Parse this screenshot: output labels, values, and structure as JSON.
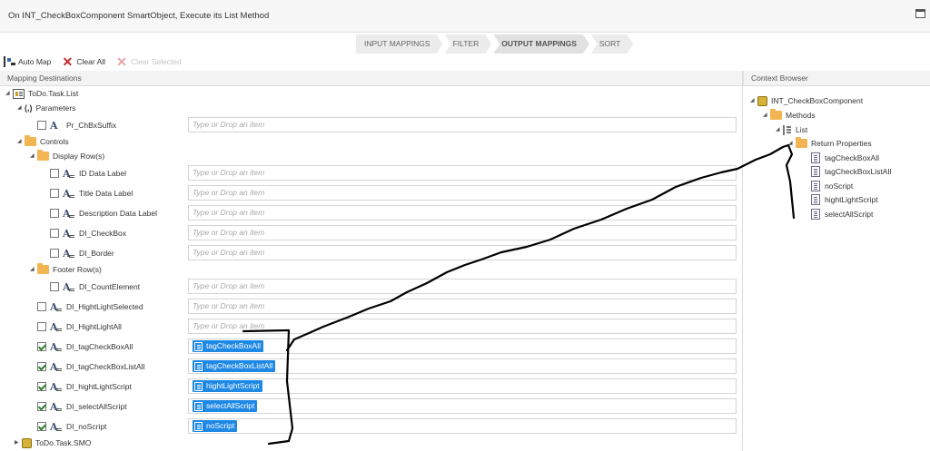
{
  "window": {
    "title": "On INT_CheckBoxComponent SmartObject, Execute its List Method"
  },
  "steps": [
    {
      "label": "INPUT MAPPINGS",
      "active": false
    },
    {
      "label": "FILTER",
      "active": false
    },
    {
      "label": "OUTPUT MAPPINGS",
      "active": true
    },
    {
      "label": "SORT",
      "active": false
    }
  ],
  "toolbar": {
    "auto_map": "Auto Map",
    "clear_all": "Clear All",
    "clear_selected": "Clear Selected"
  },
  "left_panel": {
    "header": "Mapping Destinations",
    "root": "ToDo.Task.List",
    "parameters": "Parameters",
    "pr_chbx_suffix": "Pr_ChBxSuffix",
    "controls": "Controls",
    "display_rows": "Display Row(s)",
    "footer_rows": "Footer Row(s)",
    "smo_root": "ToDo.Task.SMO",
    "placeholder": "Type or Drop an item",
    "display_items": [
      "ID Data Label",
      "Title Data Label",
      "Description Data Label",
      "DI_CheckBox",
      "DI_Border"
    ],
    "footer_items": [
      "DI_CountElement"
    ],
    "control_items": [
      {
        "label": "DI_HightLightSelected",
        "checked": false,
        "value": ""
      },
      {
        "label": "DI_HightLightAll",
        "checked": false,
        "value": ""
      },
      {
        "label": "DI_tagCheckBoxAll",
        "checked": true,
        "value": "tagCheckBoxAll"
      },
      {
        "label": "DI_tagCheckBoxListAll",
        "checked": true,
        "value": "tagCheckBoxListAll"
      },
      {
        "label": "DI_hightLightScript",
        "checked": true,
        "value": "hightLightScript"
      },
      {
        "label": "DI_selectAllScript",
        "checked": true,
        "value": "selectAllScript"
      },
      {
        "label": "DI_noScript",
        "checked": true,
        "value": "noScript"
      }
    ]
  },
  "right_panel": {
    "header": "Context Browser",
    "smartobject": "INT_CheckBoxComponent",
    "methods": "Methods",
    "list": "List",
    "return_properties": "Return Properties",
    "properties": [
      "tagCheckBoxAll",
      "tagCheckBoxListAll",
      "noScript",
      "hightLightScript",
      "selectAllScript"
    ]
  },
  "colors": {
    "chip": "#1e88e5",
    "check": "#2e7d32",
    "folder": "#f2b552",
    "clear_x": "#c62828"
  }
}
